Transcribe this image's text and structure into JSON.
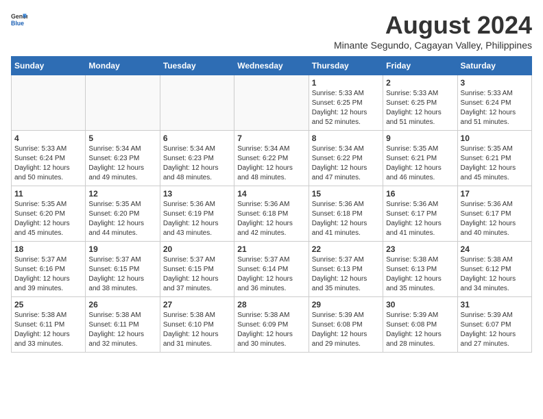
{
  "header": {
    "logo_general": "General",
    "logo_blue": "Blue",
    "month_year": "August 2024",
    "location": "Minante Segundo, Cagayan Valley, Philippines"
  },
  "days_of_week": [
    "Sunday",
    "Monday",
    "Tuesday",
    "Wednesday",
    "Thursday",
    "Friday",
    "Saturday"
  ],
  "weeks": [
    [
      {
        "day": "",
        "info": ""
      },
      {
        "day": "",
        "info": ""
      },
      {
        "day": "",
        "info": ""
      },
      {
        "day": "",
        "info": ""
      },
      {
        "day": "1",
        "sunrise": "5:33 AM",
        "sunset": "6:25 PM",
        "daylight": "12 hours and 52 minutes."
      },
      {
        "day": "2",
        "sunrise": "5:33 AM",
        "sunset": "6:25 PM",
        "daylight": "12 hours and 51 minutes."
      },
      {
        "day": "3",
        "sunrise": "5:33 AM",
        "sunset": "6:24 PM",
        "daylight": "12 hours and 51 minutes."
      }
    ],
    [
      {
        "day": "4",
        "sunrise": "5:33 AM",
        "sunset": "6:24 PM",
        "daylight": "12 hours and 50 minutes."
      },
      {
        "day": "5",
        "sunrise": "5:34 AM",
        "sunset": "6:23 PM",
        "daylight": "12 hours and 49 minutes."
      },
      {
        "day": "6",
        "sunrise": "5:34 AM",
        "sunset": "6:23 PM",
        "daylight": "12 hours and 48 minutes."
      },
      {
        "day": "7",
        "sunrise": "5:34 AM",
        "sunset": "6:22 PM",
        "daylight": "12 hours and 48 minutes."
      },
      {
        "day": "8",
        "sunrise": "5:34 AM",
        "sunset": "6:22 PM",
        "daylight": "12 hours and 47 minutes."
      },
      {
        "day": "9",
        "sunrise": "5:35 AM",
        "sunset": "6:21 PM",
        "daylight": "12 hours and 46 minutes."
      },
      {
        "day": "10",
        "sunrise": "5:35 AM",
        "sunset": "6:21 PM",
        "daylight": "12 hours and 45 minutes."
      }
    ],
    [
      {
        "day": "11",
        "sunrise": "5:35 AM",
        "sunset": "6:20 PM",
        "daylight": "12 hours and 45 minutes."
      },
      {
        "day": "12",
        "sunrise": "5:35 AM",
        "sunset": "6:20 PM",
        "daylight": "12 hours and 44 minutes."
      },
      {
        "day": "13",
        "sunrise": "5:36 AM",
        "sunset": "6:19 PM",
        "daylight": "12 hours and 43 minutes."
      },
      {
        "day": "14",
        "sunrise": "5:36 AM",
        "sunset": "6:18 PM",
        "daylight": "12 hours and 42 minutes."
      },
      {
        "day": "15",
        "sunrise": "5:36 AM",
        "sunset": "6:18 PM",
        "daylight": "12 hours and 41 minutes."
      },
      {
        "day": "16",
        "sunrise": "5:36 AM",
        "sunset": "6:17 PM",
        "daylight": "12 hours and 41 minutes."
      },
      {
        "day": "17",
        "sunrise": "5:36 AM",
        "sunset": "6:17 PM",
        "daylight": "12 hours and 40 minutes."
      }
    ],
    [
      {
        "day": "18",
        "sunrise": "5:37 AM",
        "sunset": "6:16 PM",
        "daylight": "12 hours and 39 minutes."
      },
      {
        "day": "19",
        "sunrise": "5:37 AM",
        "sunset": "6:15 PM",
        "daylight": "12 hours and 38 minutes."
      },
      {
        "day": "20",
        "sunrise": "5:37 AM",
        "sunset": "6:15 PM",
        "daylight": "12 hours and 37 minutes."
      },
      {
        "day": "21",
        "sunrise": "5:37 AM",
        "sunset": "6:14 PM",
        "daylight": "12 hours and 36 minutes."
      },
      {
        "day": "22",
        "sunrise": "5:37 AM",
        "sunset": "6:13 PM",
        "daylight": "12 hours and 35 minutes."
      },
      {
        "day": "23",
        "sunrise": "5:38 AM",
        "sunset": "6:13 PM",
        "daylight": "12 hours and 35 minutes."
      },
      {
        "day": "24",
        "sunrise": "5:38 AM",
        "sunset": "6:12 PM",
        "daylight": "12 hours and 34 minutes."
      }
    ],
    [
      {
        "day": "25",
        "sunrise": "5:38 AM",
        "sunset": "6:11 PM",
        "daylight": "12 hours and 33 minutes."
      },
      {
        "day": "26",
        "sunrise": "5:38 AM",
        "sunset": "6:11 PM",
        "daylight": "12 hours and 32 minutes."
      },
      {
        "day": "27",
        "sunrise": "5:38 AM",
        "sunset": "6:10 PM",
        "daylight": "12 hours and 31 minutes."
      },
      {
        "day": "28",
        "sunrise": "5:38 AM",
        "sunset": "6:09 PM",
        "daylight": "12 hours and 30 minutes."
      },
      {
        "day": "29",
        "sunrise": "5:39 AM",
        "sunset": "6:08 PM",
        "daylight": "12 hours and 29 minutes."
      },
      {
        "day": "30",
        "sunrise": "5:39 AM",
        "sunset": "6:08 PM",
        "daylight": "12 hours and 28 minutes."
      },
      {
        "day": "31",
        "sunrise": "5:39 AM",
        "sunset": "6:07 PM",
        "daylight": "12 hours and 27 minutes."
      }
    ]
  ]
}
